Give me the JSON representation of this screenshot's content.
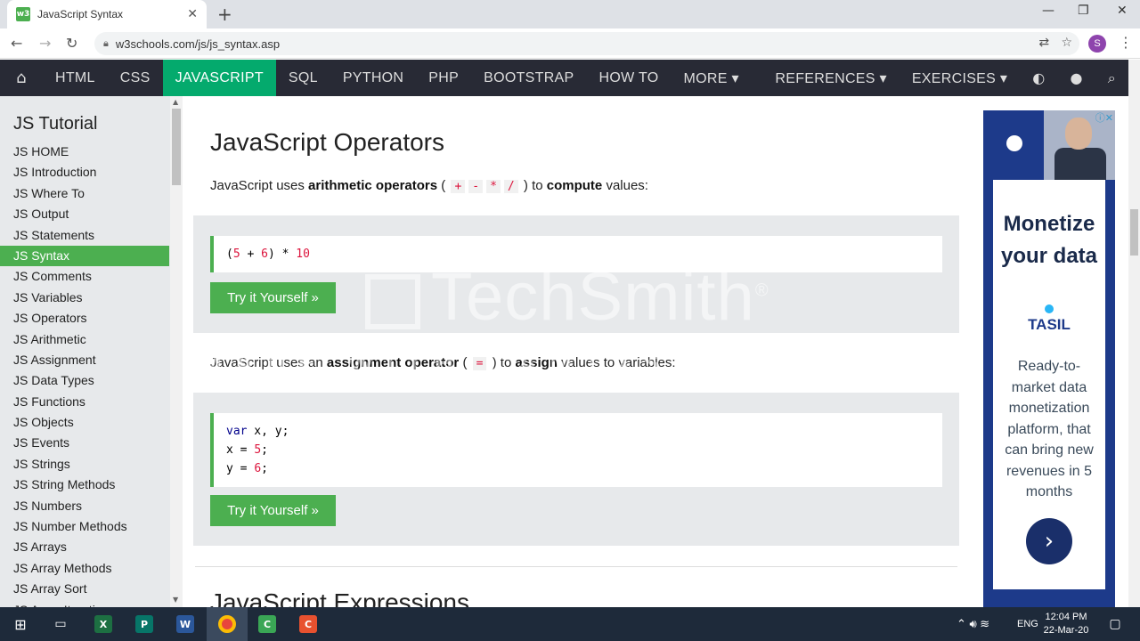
{
  "browser": {
    "tab_title": "JavaScript Syntax",
    "favicon_text": "w3",
    "url": "w3schools.com/js/js_syntax.asp",
    "profile_initial": "S"
  },
  "topnav": {
    "items": [
      "HTML",
      "CSS",
      "JAVASCRIPT",
      "SQL",
      "PYTHON",
      "PHP",
      "BOOTSTRAP",
      "HOW TO",
      "MORE ▾"
    ],
    "active": "JAVASCRIPT",
    "references": "REFERENCES ▾",
    "exercises": "EXERCISES ▾"
  },
  "sidebar": {
    "title": "JS Tutorial",
    "links": [
      "JS HOME",
      "JS Introduction",
      "JS Where To",
      "JS Output",
      "JS Statements",
      "JS Syntax",
      "JS Comments",
      "JS Variables",
      "JS Operators",
      "JS Arithmetic",
      "JS Assignment",
      "JS Data Types",
      "JS Functions",
      "JS Objects",
      "JS Events",
      "JS Strings",
      "JS String Methods",
      "JS Numbers",
      "JS Number Methods",
      "JS Arrays",
      "JS Array Methods",
      "JS Array Sort",
      "JS Array Iteration"
    ],
    "active": "JS Syntax"
  },
  "main": {
    "heading": "JavaScript Operators",
    "para1": {
      "pre": "JavaScript uses ",
      "bold1": "arithmetic operators",
      "mid": " ( ",
      "ops": [
        "+",
        "-",
        "*",
        "/"
      ],
      "post": " ) to ",
      "bold2": "compute",
      "end": " values:"
    },
    "example1": {
      "code": "(5 + 6) * 10"
    },
    "try_label": "Try it Yourself »",
    "para2": {
      "pre": "JavaScript uses an ",
      "bold1": "assignment operator",
      "mid": " ( ",
      "op": "=",
      "post": " ) to ",
      "bold2": "assign",
      "end": " values to variables:"
    },
    "example2": {
      "lines": [
        "var x, y;",
        "x = 5;",
        "y = 6;"
      ]
    },
    "next_heading": "JavaScript Expressions"
  },
  "ad": {
    "headline": "Monetize your data",
    "brand": "TASIL",
    "description": "Ready-to-market data monetization platform, that can bring new revenues in 5 months"
  },
  "watermark": {
    "brand": "TechSmith",
    "registered": "®",
    "line": "MADE WITH CAMTASIA FREE TRIAL"
  },
  "taskbar": {
    "time": "12:04 PM",
    "date": "22-Mar-20",
    "lang": "ENG"
  }
}
